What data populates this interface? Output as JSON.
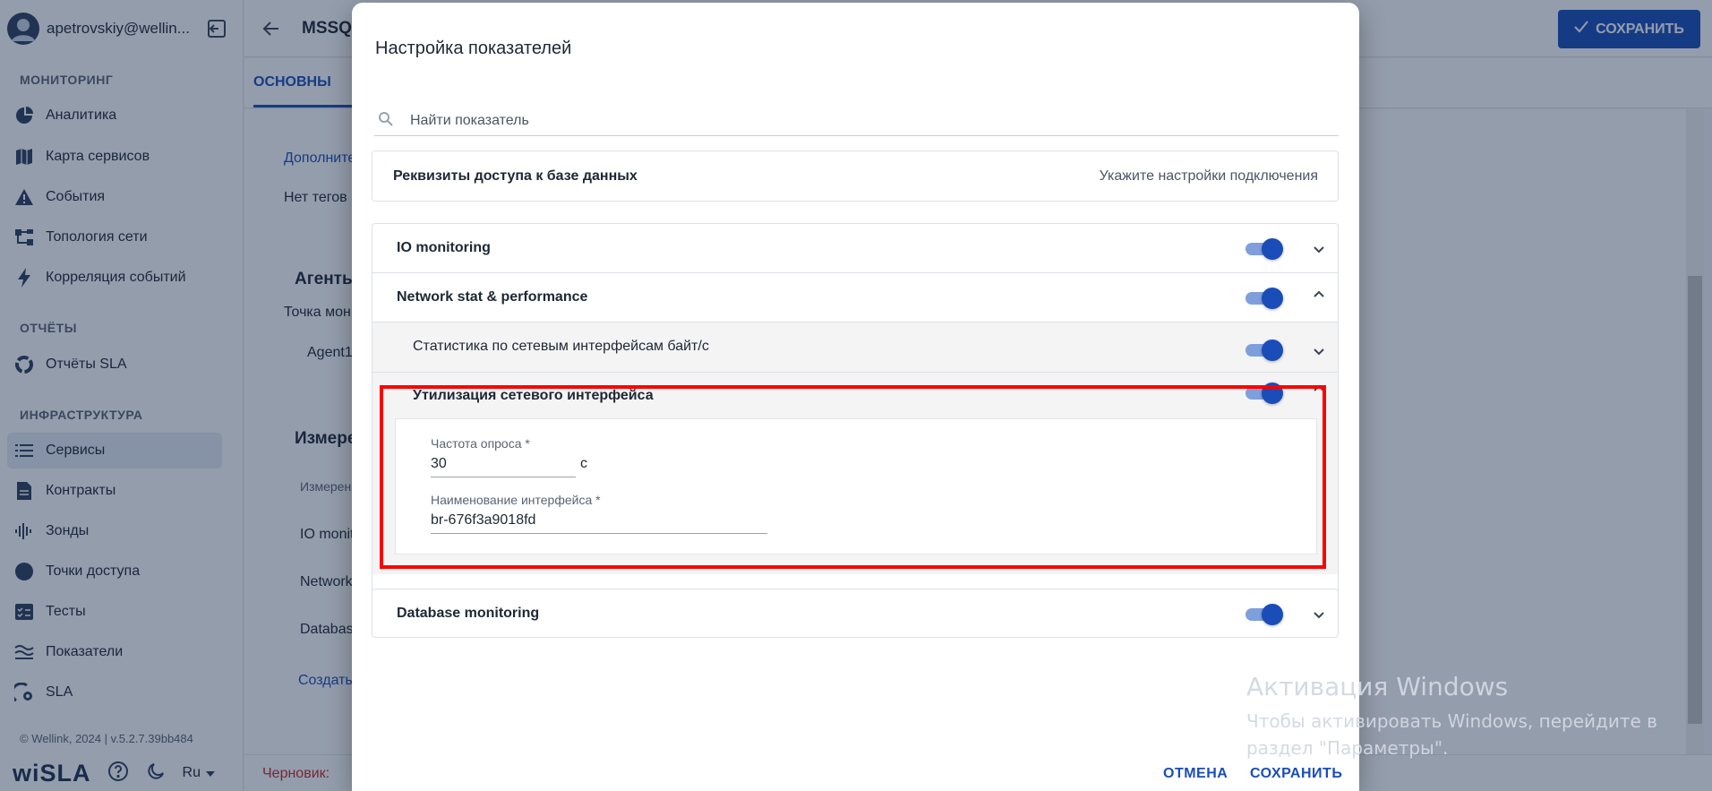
{
  "sidebar": {
    "user_email": "apetrovskiy@wellin...",
    "sections": {
      "monitoring": "МОНИТОРИНГ",
      "reports": "ОТЧЁТЫ",
      "infrastructure": "ИНФРАСТРУКТУРА"
    },
    "items": {
      "analytics": "Аналитика",
      "service_map": "Карта сервисов",
      "events": "События",
      "topology": "Топология сети",
      "correlation": "Корреляция событий",
      "sla_reports": "Отчёты SLA",
      "services": "Сервисы",
      "contracts": "Контракты",
      "probes": "Зонды",
      "access_points": "Точки доступа",
      "tests": "Тесты",
      "indicators": "Показатели",
      "sla": "SLA"
    },
    "active_item": "services",
    "footer": "© Wellink, 2024 | v.5.2.7.39bb484",
    "logo": "wiSLA",
    "language": "Ru"
  },
  "header": {
    "title": "MSSQL",
    "save_label": "СОХРАНИТЬ"
  },
  "tabs": {
    "main": "ОСНОВНЫ"
  },
  "background_content": {
    "additional": "Дополните",
    "no_tags": "Нет тегов",
    "agents_heading": "Агенты",
    "monitoring_point": "Точка мон",
    "agent": "Agent1",
    "measurements_heading": "Измере",
    "measurements_col": "Измерен",
    "row_io": "IO monit",
    "row_network": "Network",
    "row_database": "Databas",
    "create_link": "Создать",
    "draft": "Черновик:"
  },
  "modal": {
    "title": "Настройка показателей",
    "search_placeholder": "Найти показатель",
    "credentials": {
      "title": "Реквизиты доступа к базе данных",
      "hint": "Укажите настройки подключения"
    },
    "groups": [
      {
        "title": "IO monitoring",
        "enabled": true,
        "expanded": false
      },
      {
        "title": "Network stat & performance",
        "enabled": true,
        "expanded": true
      }
    ],
    "subitems": [
      {
        "title": "Статистика по сетевым интерфейсам байт/с",
        "enabled": true,
        "expanded": false
      },
      {
        "title": "Утилизация сетевого интерфейса",
        "enabled": true,
        "expanded": true
      }
    ],
    "fields": {
      "poll_rate_label": "Частота опроса *",
      "poll_rate_value": "30",
      "poll_rate_unit": "с",
      "interface_name_label": "Наименование интерфейса *",
      "interface_name_value": "br-676f3a9018fd"
    },
    "database_monitoring": {
      "title": "Database monitoring",
      "enabled": true,
      "expanded": false
    },
    "cancel_label": "ОТМЕНА",
    "save_label": "СОХРАНИТЬ"
  },
  "watermark": {
    "title": "Активация Windows",
    "subtitle": "Чтобы активировать Windows, перейдите в раздел \"Параметры\"."
  },
  "colors": {
    "accent": "#1a4db8",
    "toggle_track": "#7f9fdc",
    "highlight": "#ff0000",
    "overlay": "#122648"
  }
}
